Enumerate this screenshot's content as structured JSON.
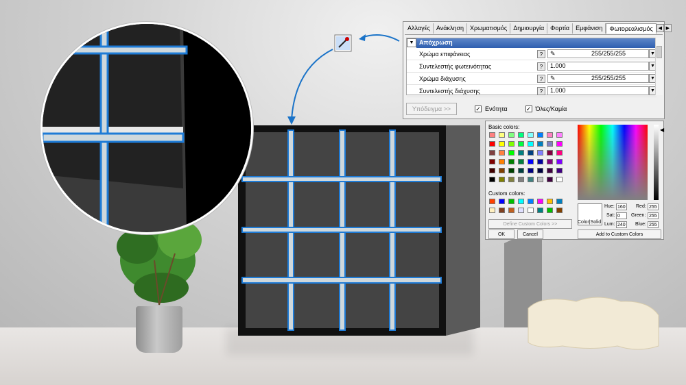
{
  "tabs": [
    "Αλλαγές",
    "Ανάκληση",
    "Χρωματισμός",
    "Δημιουργία",
    "Φορτία",
    "Εμφάνιση",
    "Φωτορεαλισμός"
  ],
  "active_tab": 6,
  "group_title": "Απόχρωση",
  "rows": [
    {
      "label": "Χρώμα επιφάνειας",
      "value": "255/255/255",
      "has_picker": true
    },
    {
      "label": "Συντελεστής φωτεινότητας",
      "value": "1.000",
      "has_picker": false
    },
    {
      "label": "Χρώμα διάχυσης",
      "value": "255/255/255",
      "has_picker": true
    },
    {
      "label": "Συντελεστής διάχυσης",
      "value": "1.000",
      "has_picker": false
    }
  ],
  "example_button": "Υπόδειγμα >>",
  "check1": "Ενότητα",
  "check2": "Όλες/Καμία",
  "color_dialog": {
    "basic_label": "Basic colors:",
    "custom_label": "Custom colors:",
    "define_button": "Define Custom Colors >>",
    "ok": "OK",
    "cancel": "Cancel",
    "add_button": "Add to Custom Colors",
    "color_solid": "Color|Solid",
    "hue_label": "Hue:",
    "hue": "160",
    "sat_label": "Sat:",
    "sat": "0",
    "lum_label": "Lum:",
    "lum": "240",
    "red_label": "Red:",
    "red": "255",
    "green_label": "Green:",
    "green": "255",
    "blue_label": "Blue:",
    "blue": "255",
    "basic_colors": [
      "#ff8080",
      "#ffff80",
      "#80ff80",
      "#00ff80",
      "#80ffff",
      "#0080ff",
      "#ff80c0",
      "#ff80ff",
      "#ff0000",
      "#ffff00",
      "#80ff00",
      "#00ff40",
      "#00ffff",
      "#0080c0",
      "#8080c0",
      "#ff00ff",
      "#804040",
      "#ff8040",
      "#00ff00",
      "#008080",
      "#004080",
      "#8080ff",
      "#800040",
      "#ff0080",
      "#800000",
      "#ff8000",
      "#008000",
      "#008040",
      "#0000ff",
      "#0000a0",
      "#800080",
      "#8000ff",
      "#400000",
      "#804000",
      "#004000",
      "#004040",
      "#000080",
      "#000040",
      "#400040",
      "#400080",
      "#000000",
      "#808000",
      "#808040",
      "#808080",
      "#408080",
      "#c0c0c0",
      "#400040",
      "#ffffff"
    ],
    "custom_colors": [
      "#ff4000",
      "#0000ff",
      "#00c000",
      "#00ffff",
      "#0080ff",
      "#ff00ff",
      "#ffc000",
      "#0080c0",
      "#fff0c0",
      "#804020",
      "#c06020",
      "#e0e0ff",
      "#ffffff",
      "#008080",
      "#00c000",
      "#804000"
    ]
  }
}
